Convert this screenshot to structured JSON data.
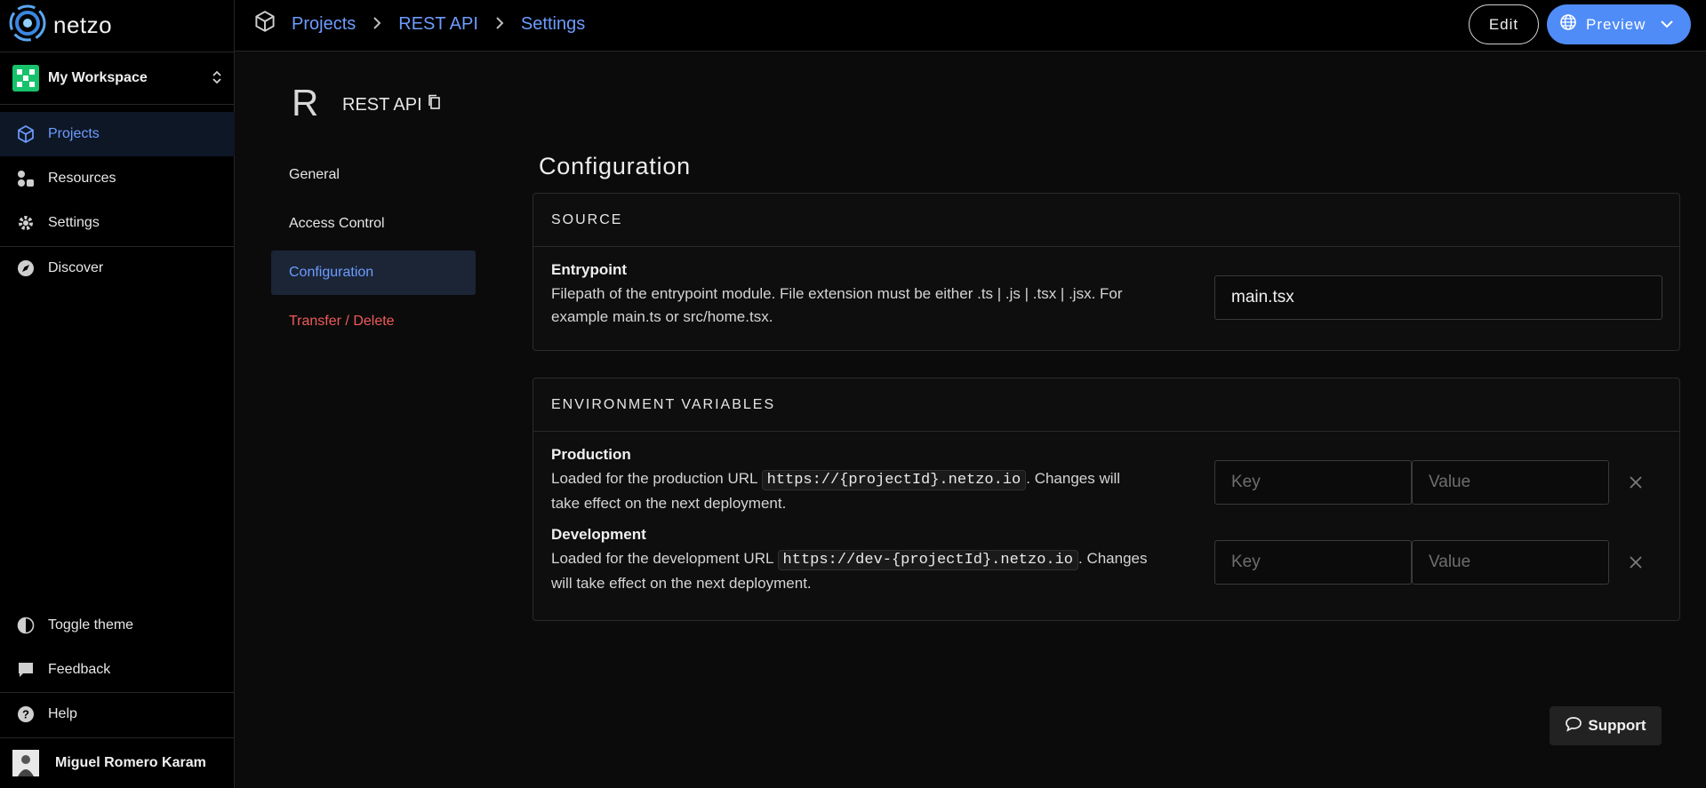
{
  "app": {
    "name": "netzo"
  },
  "workspace": {
    "label": "My Workspace"
  },
  "sidebar": {
    "items": [
      {
        "label": "Projects",
        "icon": "cube-icon",
        "active": true
      },
      {
        "label": "Resources",
        "icon": "resources-icon"
      },
      {
        "label": "Settings",
        "icon": "gear-icon"
      },
      {
        "label": "Discover",
        "icon": "compass-icon"
      }
    ],
    "bottom": [
      {
        "label": "Toggle theme",
        "icon": "contrast-icon"
      },
      {
        "label": "Feedback",
        "icon": "chat-icon"
      },
      {
        "label": "Help",
        "icon": "help-icon"
      }
    ],
    "user": "Miguel Romero Karam"
  },
  "breadcrumb": [
    "Projects",
    "REST API",
    "Settings"
  ],
  "topbar": {
    "edit_label": "Edit",
    "preview_label": "Preview"
  },
  "project": {
    "letter": "R",
    "name": "REST API"
  },
  "subnav": [
    "General",
    "Access Control",
    "Configuration",
    "Transfer / Delete"
  ],
  "main": {
    "title": "Configuration",
    "source": {
      "heading": "SOURCE",
      "entrypoint_title": "Entrypoint",
      "entrypoint_desc_1": "Filepath of the entrypoint module. File extension must be either .ts | .js | .tsx | .jsx. For",
      "entrypoint_desc_2": "example main.ts or src/home.tsx.",
      "entrypoint_value": "main.tsx"
    },
    "env": {
      "heading": "ENVIRONMENT VARIABLES",
      "production_title": "Production",
      "production_pre": "Loaded for the production URL ",
      "production_url": "https://{projectId}.netzo.io",
      "production_post": ". Changes will",
      "production_line2": "take effect on the next deployment.",
      "development_title": "Development",
      "development_pre": "Loaded for the development URL ",
      "development_url": "https://dev-{projectId}.netzo.io",
      "development_post": ". Changes",
      "development_line2": "will take effect on the next deployment.",
      "key_placeholder": "Key",
      "value_placeholder": "Value"
    }
  },
  "support_label": "Support",
  "colors": {
    "accent": "#4f8cf7",
    "link": "#6d9cff",
    "danger": "#f05a5a",
    "workspace": "#16c26b"
  }
}
